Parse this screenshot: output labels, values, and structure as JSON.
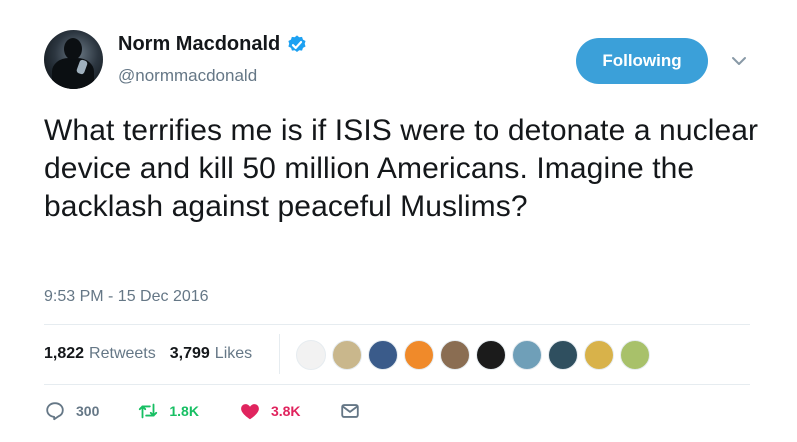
{
  "author": {
    "display_name": "Norm Macdonald",
    "handle": "@normmacdonald",
    "verified": true,
    "verified_color": "#1da1f2"
  },
  "follow_button": {
    "label": "Following",
    "color": "#3ba0d9"
  },
  "tweet": {
    "text": "What terrifies me is if ISIS were to detonate a nuclear device and kill 50 million Americans. Imagine the backlash against peaceful Muslims?",
    "timestamp": "9:53 PM - 15 Dec 2016"
  },
  "stats": {
    "retweets_count": "1,822",
    "retweets_label": "Retweets",
    "likes_count": "3,799",
    "likes_label": "Likes"
  },
  "likers": [
    {
      "color": "#f2f2f2"
    },
    {
      "color": "#c9b78c"
    },
    {
      "color": "#3a5b8a"
    },
    {
      "color": "#f08a2a"
    },
    {
      "color": "#8a6d52"
    },
    {
      "color": "#1b1b1b"
    },
    {
      "color": "#6f9fb8"
    },
    {
      "color": "#2f4f5f"
    },
    {
      "color": "#d8b24a"
    },
    {
      "color": "#a8c16a"
    }
  ],
  "actions": {
    "reply_count": "300",
    "retweet_count": "1.8K",
    "like_count": "3.8K",
    "retweet_color": "#17bf63",
    "like_color": "#e0245e"
  }
}
